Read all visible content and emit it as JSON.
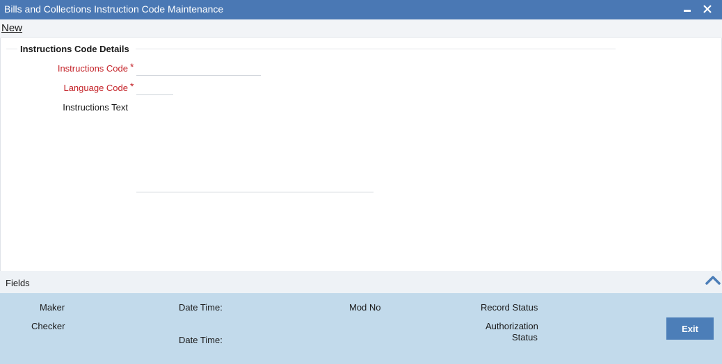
{
  "window": {
    "title": "Bills and Collections Instruction Code Maintenance",
    "minimize_glyph": "▬",
    "close_glyph": "✕"
  },
  "menu": {
    "new_label": "New"
  },
  "section": {
    "title": "Instructions Code Details"
  },
  "form": {
    "instructions_code_label": "Instructions Code",
    "instructions_code_value": "",
    "language_code_label": "Language Code",
    "language_code_value": "",
    "instructions_text_label": "Instructions Text",
    "instructions_text_value": "",
    "required_marker": "*"
  },
  "fields_bar": {
    "label": "Fields",
    "collapse_icon": "chevron-up-icon"
  },
  "footer": {
    "maker_label": "Maker",
    "checker_label": "Checker",
    "datetime_label_1": "Date Time:",
    "datetime_label_2": "Date Time:",
    "mod_no_label": "Mod No",
    "record_status_label": "Record Status",
    "authorization_label_line1": "Authorization",
    "authorization_label_line2": "Status",
    "exit_label": "Exit"
  },
  "colors": {
    "titlebar": "#4a78b4",
    "required": "#c42127",
    "footer": "#c2daeb",
    "exit_button": "#4c7eb8",
    "chevron": "#4c7eb8"
  }
}
